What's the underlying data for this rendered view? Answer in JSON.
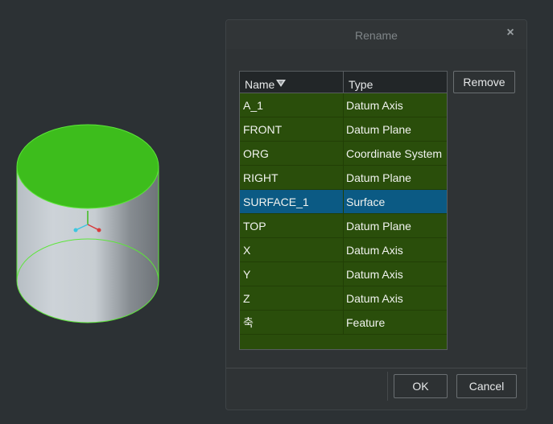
{
  "dialog": {
    "title": "Rename",
    "close_label": "×"
  },
  "table": {
    "headers": {
      "name": "Name",
      "type": "Type"
    },
    "rows": [
      {
        "name": "A_1",
        "type": "Datum Axis"
      },
      {
        "name": "FRONT",
        "type": "Datum Plane"
      },
      {
        "name": "ORG",
        "type": "Coordinate System"
      },
      {
        "name": "RIGHT",
        "type": "Datum Plane"
      },
      {
        "name": "SURFACE_1",
        "type": "Surface"
      },
      {
        "name": "TOP",
        "type": "Datum Plane"
      },
      {
        "name": "X",
        "type": "Datum Axis"
      },
      {
        "name": "Y",
        "type": "Datum Axis"
      },
      {
        "name": "Z",
        "type": "Datum Axis"
      },
      {
        "name": "축",
        "type": "Feature"
      }
    ],
    "selected_row": "SURFACE_1"
  },
  "buttons": {
    "remove": "Remove",
    "ok": "OK",
    "cancel": "Cancel"
  },
  "colors": {
    "row_bg": "#2a4e0b",
    "selected_bg": "#0b5a84",
    "cylinder_top": "#3dbd1c",
    "cylinder_edge": "#5de63a"
  }
}
